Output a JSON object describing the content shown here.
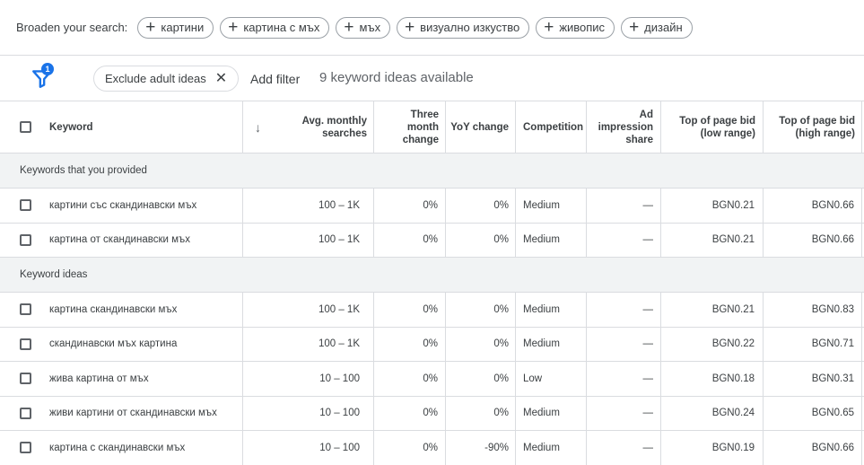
{
  "broaden": {
    "label": "Broaden your search:",
    "chips": [
      "картини",
      "картина с мъх",
      "мъх",
      "визуално изкуство",
      "живопис",
      "дизайн"
    ]
  },
  "filters": {
    "badge_count": "1",
    "exclude_chip": "Exclude adult ideas",
    "add_filter": "Add filter",
    "ideas_available": "9 keyword ideas available"
  },
  "table": {
    "headers": {
      "keyword": "Keyword",
      "avg_monthly": "Avg. monthly searches",
      "three_month": "Three month change",
      "yoy": "YoY change",
      "competition": "Competition",
      "ad_impression": "Ad impression share",
      "bid_low": "Top of page bid (low range)",
      "bid_high": "Top of page bid (high range)"
    },
    "groups": [
      {
        "title": "Keywords that you provided",
        "rows": [
          {
            "keyword": "картини със скандинавски мъх",
            "avg": "100 – 1K",
            "three": "0%",
            "yoy": "0%",
            "comp": "Medium",
            "ad": "—",
            "low": "BGN0.21",
            "high": "BGN0.66"
          },
          {
            "keyword": "картина от скандинавски мъх",
            "avg": "100 – 1K",
            "three": "0%",
            "yoy": "0%",
            "comp": "Medium",
            "ad": "—",
            "low": "BGN0.21",
            "high": "BGN0.66"
          }
        ]
      },
      {
        "title": "Keyword ideas",
        "rows": [
          {
            "keyword": "картина скандинавски мъх",
            "avg": "100 – 1K",
            "three": "0%",
            "yoy": "0%",
            "comp": "Medium",
            "ad": "—",
            "low": "BGN0.21",
            "high": "BGN0.83"
          },
          {
            "keyword": "скандинавски мъх картина",
            "avg": "100 – 1K",
            "three": "0%",
            "yoy": "0%",
            "comp": "Medium",
            "ad": "—",
            "low": "BGN0.22",
            "high": "BGN0.71"
          },
          {
            "keyword": "жива картина от мъх",
            "avg": "10 – 100",
            "three": "0%",
            "yoy": "0%",
            "comp": "Low",
            "ad": "—",
            "low": "BGN0.18",
            "high": "BGN0.31"
          },
          {
            "keyword": "живи картини от скандинавски мъх",
            "avg": "10 – 100",
            "three": "0%",
            "yoy": "0%",
            "comp": "Medium",
            "ad": "—",
            "low": "BGN0.24",
            "high": "BGN0.65"
          },
          {
            "keyword": "картина с скандинавски мъх",
            "avg": "10 – 100",
            "three": "0%",
            "yoy": "-90%",
            "comp": "Medium",
            "ad": "—",
            "low": "BGN0.19",
            "high": "BGN0.66"
          }
        ]
      }
    ]
  },
  "colors": {
    "accent": "#1a73e8",
    "group_bg": "#f1f3f4",
    "divider": "#dadce0"
  }
}
